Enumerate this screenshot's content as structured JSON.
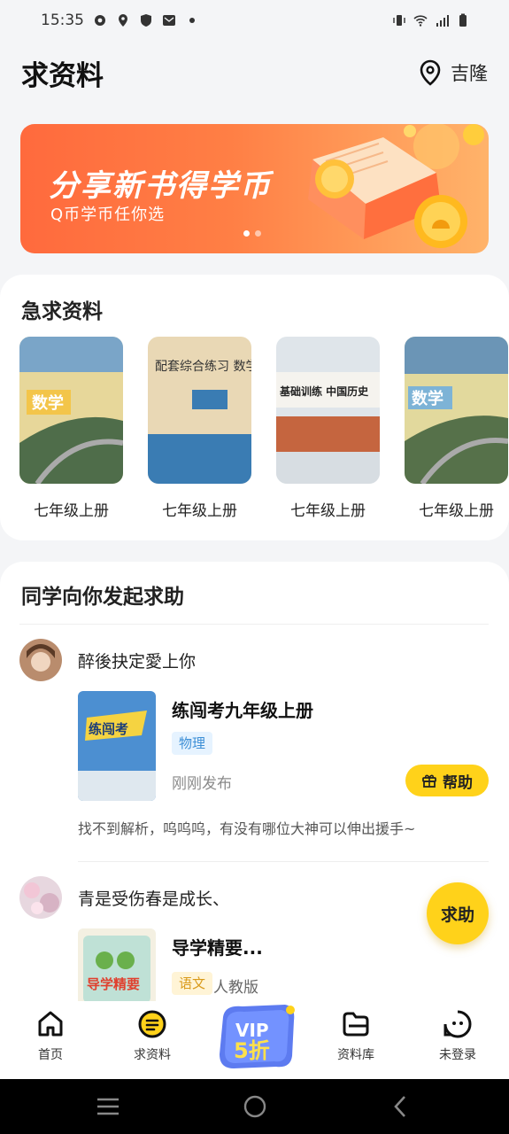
{
  "status_bar": {
    "time": "15:35",
    "icons": [
      "settings-icon",
      "location-icon",
      "shield-icon",
      "mail-icon",
      "dot-icon",
      "vibrate-icon",
      "wifi-icon",
      "signal-icon",
      "battery-icon"
    ]
  },
  "header": {
    "title": "求资料",
    "location": "吉隆"
  },
  "banner": {
    "title": "分享新书得学币",
    "subtitle": "Q币学币任你选",
    "slide_count": 2,
    "active_slide": 1
  },
  "urgent": {
    "title": "急求资料",
    "books": [
      {
        "label": "七年级上册",
        "cover_text": "数学"
      },
      {
        "label": "七年级上册",
        "cover_text": "配套综合练习 数学"
      },
      {
        "label": "七年级上册",
        "cover_text": "基础训练 中国历史"
      },
      {
        "label": "七年级上册",
        "cover_text": "数学"
      }
    ]
  },
  "help_section": {
    "title": "同学向你发起求助",
    "posts": [
      {
        "username": "醉後抉定愛上你",
        "book_title": "练闯考九年级上册",
        "subject": "物理",
        "time": "刚刚发布",
        "help_label": "帮助",
        "description": "找不到解析，呜呜呜，有没有哪位大神可以伸出援手~",
        "cover_text": "练闯考"
      },
      {
        "username": "青是受伤春是成长、",
        "book_title": "导学精要...",
        "subject": "语文",
        "edition": "人教版",
        "cover_text": "导学精要"
      }
    ]
  },
  "fab": {
    "label": "求助"
  },
  "tab_bar": {
    "items": [
      {
        "label": "首页",
        "icon": "home-icon"
      },
      {
        "label": "求资料",
        "icon": "request-icon"
      },
      {
        "label": "资料库",
        "icon": "folder-icon"
      },
      {
        "label": "未登录",
        "icon": "user-icon"
      }
    ],
    "vip": {
      "line1": "VIP",
      "line2": "5折"
    }
  },
  "colors": {
    "accent": "#ffd21a",
    "banner_start": "#ff6a3d",
    "banner_end": "#ffb36a",
    "tag_blue": "#3d8fd6",
    "tag_yellow": "#d99a1a"
  }
}
